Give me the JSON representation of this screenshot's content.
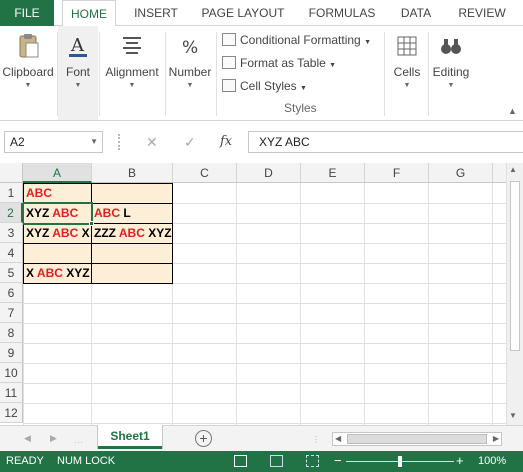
{
  "ribbon_tabs": [
    "FILE",
    "HOME",
    "INSERT",
    "PAGE LAYOUT",
    "FORMULAS",
    "DATA",
    "REVIEW"
  ],
  "ribbon": {
    "clipboard": "Clipboard",
    "font": "Font",
    "alignment": "Alignment",
    "number": "Number",
    "conditional_formatting": "Conditional Formatting",
    "format_as_table": "Format as Table",
    "cell_styles": "Cell Styles",
    "styles_group": "Styles",
    "cells": "Cells",
    "editing": "Editing"
  },
  "formula_bar": {
    "name_box": "A2",
    "cancel": "✕",
    "enter": "✓",
    "fx": "fx",
    "formula": "XYZ ABC"
  },
  "columns": [
    "A",
    "B",
    "C",
    "D",
    "E",
    "F",
    "G"
  ],
  "rows": [
    "1",
    "2",
    "3",
    "4",
    "5",
    "6",
    "7",
    "8",
    "9",
    "10",
    "11",
    "12"
  ],
  "cells": {
    "a1": {
      "red": "ABC"
    },
    "a2": {
      "black": "XYZ ",
      "red": "ABC"
    },
    "b2": {
      "red": "ABC",
      "black": " L"
    },
    "a3": {
      "black": "XYZ ",
      "red": "ABC",
      "black2": " X"
    },
    "b3": {
      "black": "ZZZ ",
      "red": "ABC",
      "black2": " XYZ"
    },
    "a5": {
      "black": "X ",
      "red": "ABC",
      "black2": " XYZ"
    }
  },
  "sheet_tab": "Sheet1",
  "status": {
    "ready": "READY",
    "numlock": "NUM LOCK",
    "zoom": "100%"
  },
  "colors": {
    "accent": "#217346",
    "highlight": "#fdeed7",
    "red_text": "#e02020"
  }
}
